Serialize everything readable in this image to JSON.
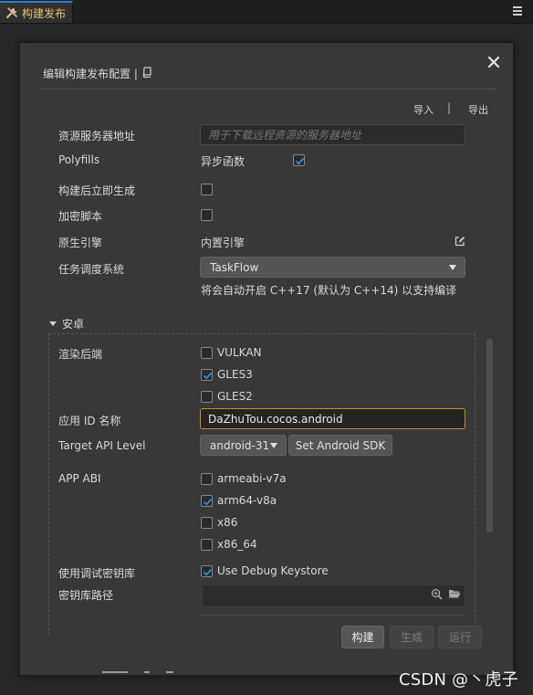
{
  "tab": {
    "title": "构建发布"
  },
  "dialog": {
    "title": "编辑构建发布配置 |",
    "import_label": "导入",
    "separator": "|",
    "export_label": "导出"
  },
  "fields": {
    "resource_server": {
      "label": "资源服务器地址",
      "placeholder": "用于下载远程资源的服务器地址"
    },
    "polyfills": {
      "label": "Polyfills",
      "option": "异步函数",
      "checked": true
    },
    "build_gen": {
      "label": "构建后立即生成",
      "checked": false
    },
    "encrypt": {
      "label": "加密脚本",
      "checked": false
    },
    "native_engine": {
      "label": "原生引擎",
      "value": "内置引擎"
    },
    "task_scheduler": {
      "label": "任务调度系统",
      "selected": "TaskFlow",
      "hint": "将会自动开启 C++17 (默认为 C++14) 以支持编译"
    }
  },
  "android": {
    "section_title": "安卓",
    "render_backend": {
      "label": "渲染后端",
      "options": [
        {
          "label": "VULKAN",
          "checked": false
        },
        {
          "label": "GLES3",
          "checked": true
        },
        {
          "label": "GLES2",
          "checked": false
        }
      ]
    },
    "app_id": {
      "label": "应用 ID 名称",
      "value": "DaZhuTou.cocos.android"
    },
    "target_api": {
      "label": "Target API Level",
      "selected": "android-31",
      "sdk_button": "Set Android SDK"
    },
    "app_abi": {
      "label": "APP ABI",
      "options": [
        {
          "label": "armeabi-v7a",
          "checked": false
        },
        {
          "label": "arm64-v8a",
          "checked": true
        },
        {
          "label": "x86",
          "checked": false
        },
        {
          "label": "x86_64",
          "checked": false
        }
      ]
    },
    "debug_keystore": {
      "label": "使用调试密钥库",
      "option": "Use Debug Keystore",
      "checked": true
    },
    "keystore_path": {
      "label": "密钥库路径",
      "value": ""
    }
  },
  "footer": {
    "build": "构建",
    "make": "生成",
    "run": "运行"
  },
  "watermark": "CSDN @丶虎子",
  "colors": {
    "accent_orange": "#d28d2a",
    "check_blue": "#2f8ee0",
    "tab_blue": "#2f7fd0"
  }
}
